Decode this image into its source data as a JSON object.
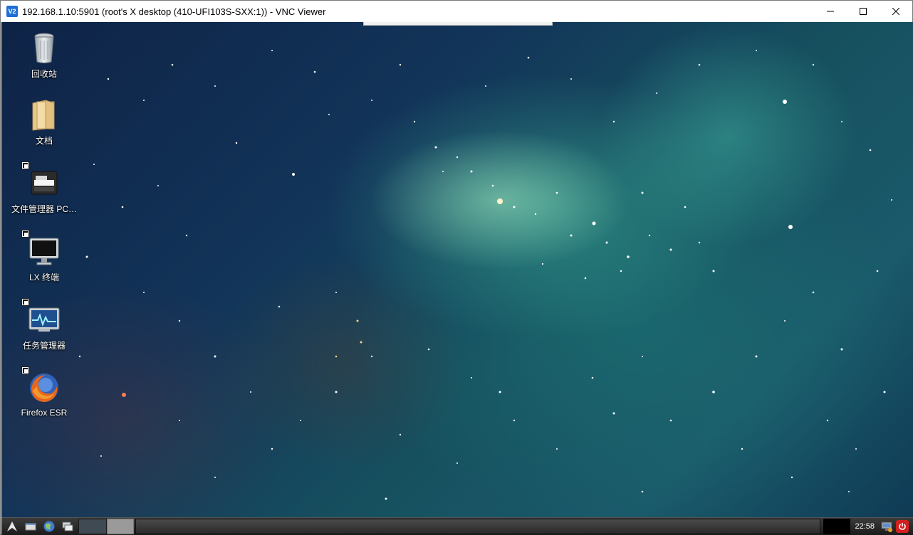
{
  "window": {
    "title": "192.168.1.10:5901 (root's X desktop (410-UFI103S-SXX:1)) - VNC Viewer",
    "app_icon_text": "V2",
    "controls": {
      "minimize_icon": "minimize-icon",
      "maximize_icon": "maximize-icon",
      "close_icon": "close-icon"
    }
  },
  "desktop": {
    "icons": [
      {
        "label": "回收站",
        "icon": "trash-icon",
        "shortcut": false
      },
      {
        "label": "文档",
        "icon": "folder-icon",
        "shortcut": false
      },
      {
        "label": "文件管理器 PC…",
        "icon": "file-manager-icon",
        "shortcut": true
      },
      {
        "label": "LX 终端",
        "icon": "terminal-icon",
        "shortcut": true
      },
      {
        "label": "任务管理器",
        "icon": "task-manager-icon",
        "shortcut": true
      },
      {
        "label": "Firefox ESR",
        "icon": "firefox-icon",
        "shortcut": true
      }
    ]
  },
  "taskbar": {
    "clock": "22:58",
    "items": [
      "menu-icon",
      "show-desktop-icon",
      "browser-icon",
      "window-switcher-icon",
      "network-icon",
      "power-icon"
    ],
    "colors": {
      "power": "#d21f1f"
    }
  }
}
